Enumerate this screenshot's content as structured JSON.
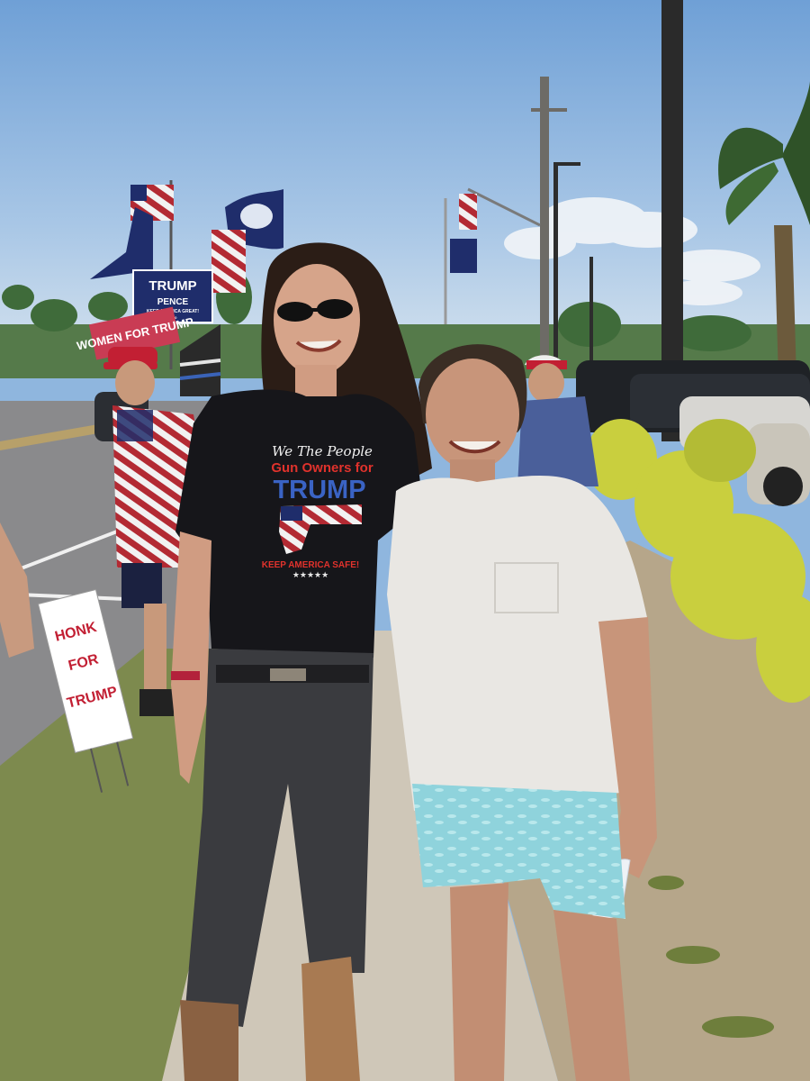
{
  "scene": {
    "description_tags": [
      "outdoor",
      "roadside",
      "rally",
      "two-people",
      "flags",
      "signs"
    ]
  },
  "signs": {
    "trump_pence_top": "TRUMP",
    "trump_pence_bottom": "PENCE",
    "trump_pence_tagline": "KEEP AMERICA GREAT!",
    "trump_pence_year": "2020",
    "women_for_trump": "WOMEN FOR TRUMP",
    "honk_line1": "HONK",
    "honk_line2": "FOR",
    "honk_line3": "TRUMP"
  },
  "shirt": {
    "line1": "We The People",
    "line2": "Gun Owners for",
    "line3": "TRUMP",
    "line4": "KEEP AMERICA SAFE!",
    "stars": "★★★★★"
  },
  "colors": {
    "sky": "#8fb6de",
    "sky_light": "#c9dcee",
    "road": "#8a8a8c",
    "grass": "#7d8a4e",
    "dirt": "#b6a68a",
    "sidewalk": "#cfc7b8",
    "shrubs": "#c9cf3e",
    "navy": "#1f2d6b",
    "red": "#b32a33"
  }
}
